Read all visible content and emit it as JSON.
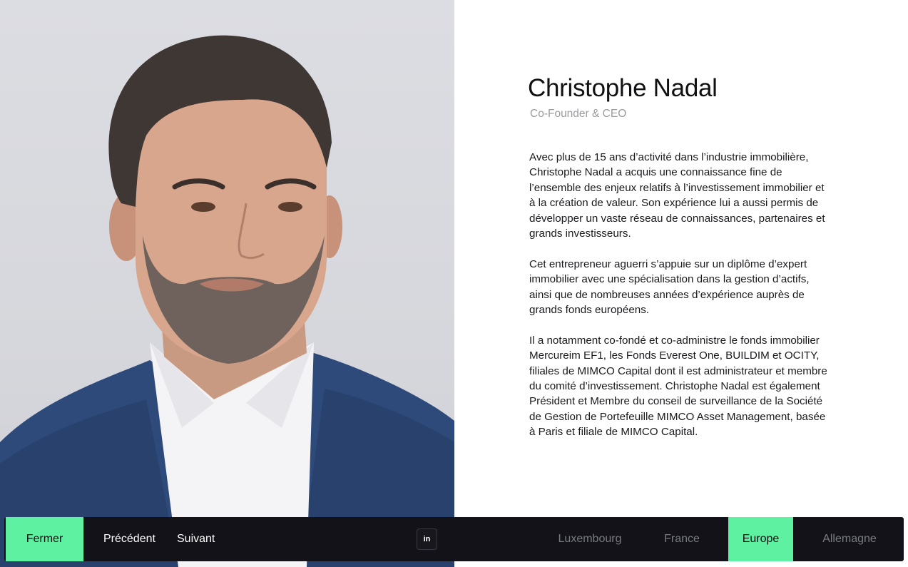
{
  "profile": {
    "name": "Christophe Nadal",
    "role": "Co-Founder & CEO",
    "bio": [
      "Avec plus de 15 ans d’activité dans l’industrie immobilière, Christophe Nadal a acquis une connaissance fine de l’ensemble des enjeux relatifs à l’investissement immobilier et à la création de valeur. Son expérience lui a aussi permis de développer un vaste réseau de connaissances, partenaires et grands investisseurs.",
      "Cet entrepreneur aguerri s’appuie sur un diplôme d’expert immobilier avec une spécialisation dans la gestion d’actifs, ainsi que de nombreuses années d’expérience auprès de grands fonds européens.",
      "Il a notamment co-fondé et co-administre le fonds immobilier Mercureim EF1, les Fonds Everest One, BUILDIM et OCITY, filiales de MIMCO Capital dont il est administrateur et membre du comité d’investissement. Christophe Nadal est également Président et Membre du conseil de surveillance de la Société de Gestion de Portefeuille MIMCO Asset Management, basée à Paris et filiale de MIMCO Capital."
    ]
  },
  "bar": {
    "close_label": "Fermer",
    "prev_label": "Précédent",
    "next_label": "Suivant",
    "linkedin_label": "in",
    "regions": [
      {
        "label": "Luxembourg",
        "active": false
      },
      {
        "label": "France",
        "active": false
      },
      {
        "label": "Europe",
        "active": true
      },
      {
        "label": "Allemagne",
        "active": false
      }
    ]
  },
  "colors": {
    "accent": "#5ef1a2",
    "bar_bg": "#121218",
    "text": "#1a1a1e",
    "muted": "#9a9aa0"
  },
  "icons": {
    "linkedin": "linkedin-icon"
  }
}
